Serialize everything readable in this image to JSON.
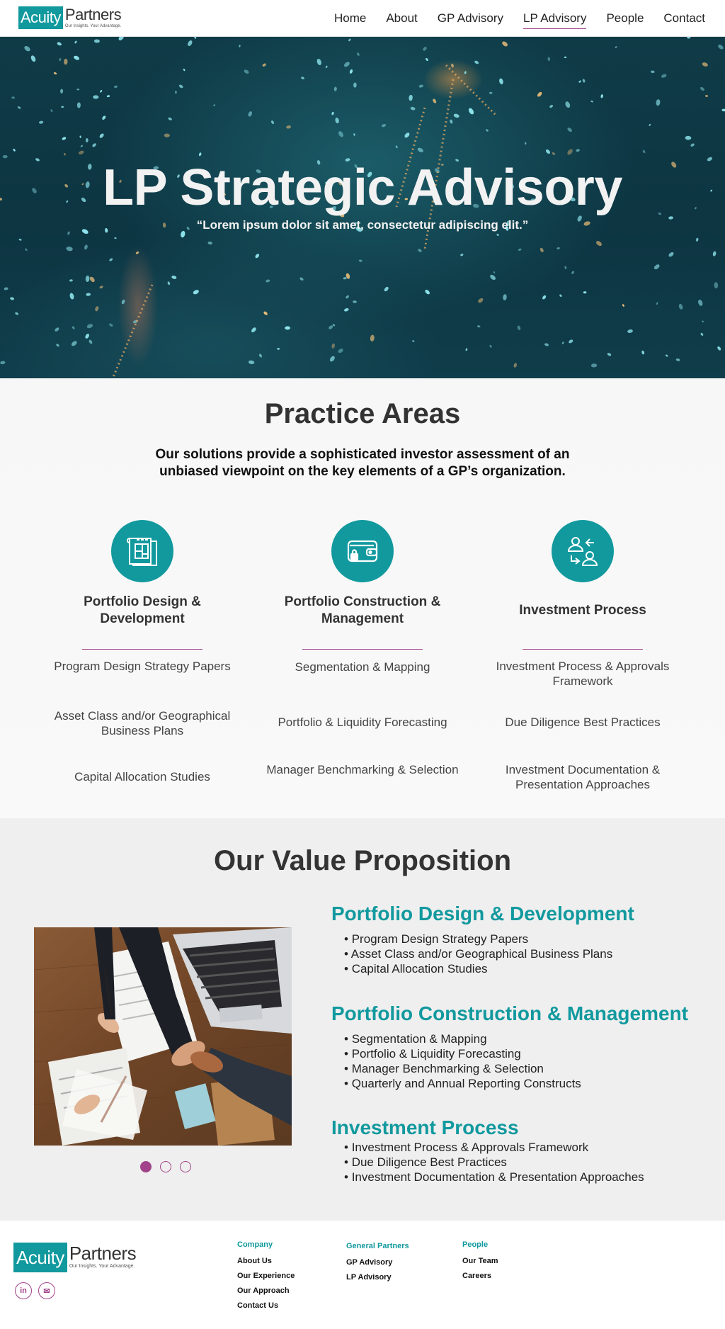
{
  "brand": {
    "name_box": "Acuity",
    "name_word": "Partners",
    "tagline": "Our Insights. Your Advantage.",
    "accent": "#11999e",
    "highlight": "#a2428a"
  },
  "nav": {
    "items": [
      {
        "label": "Home"
      },
      {
        "label": "About"
      },
      {
        "label": "GP Advisory"
      },
      {
        "label": "LP Advisory"
      },
      {
        "label": "People"
      },
      {
        "label": "Contact"
      }
    ],
    "active": "LP Advisory"
  },
  "hero": {
    "title": "LP Strategic Advisory",
    "subtitle": "“Lorem ipsum dolor sit amet, consectetur adipiscing elit.”"
  },
  "practice": {
    "title": "Practice Areas",
    "intro": "Our solutions provide a sophisticated investor assessment of an unbiased viewpoint on the key elements of a GP’s organization.",
    "columns": [
      {
        "icon": "blueprint-icon",
        "title": "Portfolio Design & Development",
        "items": [
          "Program Design Strategy Papers",
          "Asset Class and/or Geographical Business Plans",
          "Capital Allocation Studies"
        ]
      },
      {
        "icon": "wallet-icon",
        "title": "Portfolio Construction & Management",
        "items": [
          "Segmentation & Mapping",
          "Portfolio & Liquidity Forecasting",
          "Manager Benchmarking & Selection"
        ]
      },
      {
        "icon": "people-exchange-icon",
        "title": "Investment Process",
        "items": [
          "Investment Process & Approvals Framework",
          "Due Diligence Best Practices",
          "Investment Documentation & Presentation  Approaches"
        ]
      }
    ]
  },
  "value": {
    "title": "Our Value Proposition",
    "carousel_slides": 3,
    "carousel_active": 1,
    "groups": [
      {
        "title": "Portfolio Design & Development",
        "items": [
          "Program Design Strategy Papers",
          "Asset Class and/or Geographical Business Plans",
          "Capital Allocation Studies"
        ]
      },
      {
        "title": "Portfolio Construction & Management",
        "items": [
          "Segmentation & Mapping",
          "Portfolio & Liquidity Forecasting",
          "Manager Benchmarking & Selection",
          "Quarterly and Annual Reporting Constructs"
        ]
      },
      {
        "title": "Investment Process",
        "items": [
          "Investment Process & Approvals Framework",
          "Due Diligence Best Practices",
          "Investment Documentation & Presentation  Approaches"
        ]
      }
    ]
  },
  "footer": {
    "social": [
      {
        "icon": "linkedin-icon",
        "glyph": "in"
      },
      {
        "icon": "email-icon",
        "glyph": "✉"
      }
    ],
    "columns": [
      {
        "heading": "Company",
        "links": [
          "About Us",
          "Our Experience",
          "Our Approach",
          "Contact Us"
        ]
      },
      {
        "heading": "General Partners",
        "links": [
          "GP Advisory",
          "LP Advisory"
        ]
      },
      {
        "heading": "People",
        "links": [
          "Our Team",
          "Careers"
        ]
      }
    ]
  }
}
